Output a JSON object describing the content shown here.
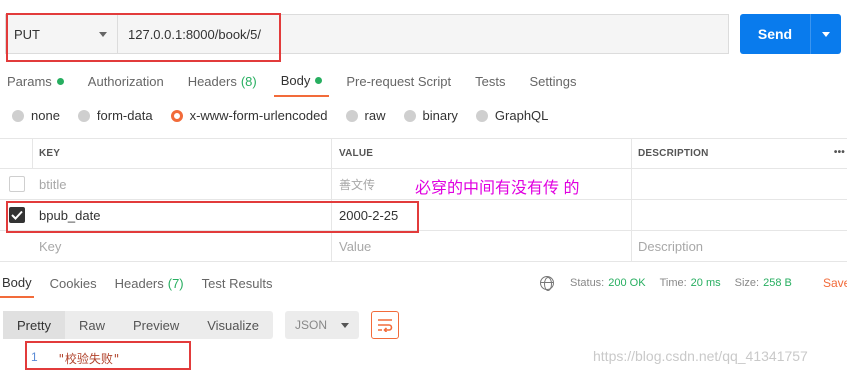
{
  "request": {
    "method": "PUT",
    "url": "127.0.0.1:8000/book/5/",
    "send_label": "Send"
  },
  "tabs": [
    {
      "label": "Params",
      "has_dot": true
    },
    {
      "label": "Authorization"
    },
    {
      "label": "Headers",
      "count": "(8)"
    },
    {
      "label": "Body",
      "has_dot": true,
      "active": true
    },
    {
      "label": "Pre-request Script"
    },
    {
      "label": "Tests"
    },
    {
      "label": "Settings"
    }
  ],
  "body_types": [
    {
      "label": "none"
    },
    {
      "label": "form-data"
    },
    {
      "label": "x-www-form-urlencoded",
      "selected": true
    },
    {
      "label": "raw"
    },
    {
      "label": "binary"
    },
    {
      "label": "GraphQL"
    }
  ],
  "table": {
    "headers": {
      "key": "KEY",
      "value": "VALUE",
      "description": "DESCRIPTION",
      "more": "•••"
    },
    "rows": [
      {
        "checked": false,
        "key": "btitle",
        "value": "善文传",
        "description": ""
      },
      {
        "checked": true,
        "key": "bpub_date",
        "value": "2000-2-25",
        "description": ""
      }
    ],
    "placeholder": {
      "key": "Key",
      "value": "Value",
      "description": "Description"
    }
  },
  "annotation": "必穿的中间有没有传 的",
  "response": {
    "tabs": [
      {
        "label": "Body",
        "active": true
      },
      {
        "label": "Cookies"
      },
      {
        "label": "Headers",
        "count": "(7)"
      },
      {
        "label": "Test Results"
      }
    ],
    "status_label": "Status:",
    "status": "200 OK",
    "time_label": "Time:",
    "time": "20 ms",
    "size_label": "Size:",
    "size": "258 B",
    "save_label": "Save",
    "views": [
      "Pretty",
      "Raw",
      "Preview",
      "Visualize"
    ],
    "format": "JSON",
    "line_number": "1",
    "body": "\"校验失败\""
  },
  "watermark": "https://blog.csdn.net/qq_41341757",
  "colors": {
    "accent": "#f26b3a",
    "send": "#097bed",
    "success": "#27ae60",
    "annotation": "#e000e0",
    "highlight_box": "#e23b3b"
  }
}
